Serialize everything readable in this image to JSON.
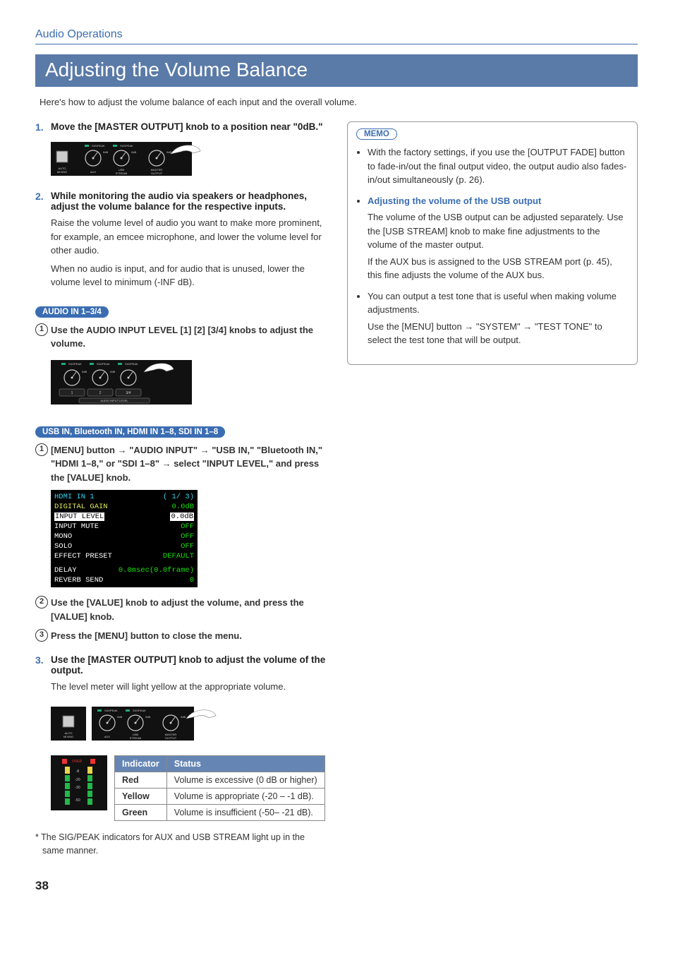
{
  "section_label": "Audio Operations",
  "title": "Adjusting the Volume Balance",
  "intro": "Here's how to adjust the volume balance of each input and the overall volume.",
  "step1": {
    "num": "1.",
    "title": "Move the [MASTER OUTPUT] knob to a position near \"0dB.\""
  },
  "step2": {
    "num": "2.",
    "title": "While monitoring the audio via speakers or headphones, adjust the volume balance for the respective inputs.",
    "p1": "Raise the volume level of audio you want to make more prominent, for example, an emcee microphone, and lower the volume level for other audio.",
    "p2": "When no audio is input, and for audio that is unused, lower the volume level to minimum (-INF dB)."
  },
  "pill_audio_in": "AUDIO IN 1–3/4",
  "sub1": {
    "text": "Use the AUDIO INPUT LEVEL [1] [2] [3/4] knobs to adjust the volume."
  },
  "pill_usb_in": "USB IN, Bluetooth IN, HDMI IN 1–8, SDI IN 1–8",
  "sub_usb1": {
    "pre": "[MENU] button ",
    "mid1": " \"AUDIO INPUT\" ",
    "mid2": " \"USB IN,\" \"Bluetooth IN,\" \"HDMI 1–8,\" or \"SDI 1–8\" ",
    "post": " select \"INPUT LEVEL,\" and press the [VALUE] knob."
  },
  "menu": {
    "r1_l": "HDMI IN 1",
    "r1_r": "( 1/ 3)",
    "r2_l": "DIGITAL GAIN",
    "r2_r": "0.0dB",
    "r3_l": "INPUT LEVEL",
    "r3_r": "0.0dB",
    "r4_l": "INPUT MUTE",
    "r4_r": "OFF",
    "r5_l": "MONO",
    "r5_r": "OFF",
    "r6_l": "SOLO",
    "r6_r": "OFF",
    "r7_l": "EFFECT PRESET",
    "r7_r": "DEFAULT",
    "r8_l": "DELAY",
    "r8_r": "0.0msec(0.0frame)",
    "r9_l": "REVERB SEND",
    "r9_r": "0"
  },
  "sub_usb2": "Use the [VALUE] knob to adjust the volume, and press the [VALUE] knob.",
  "sub_usb3": "Press the [MENU] button to close the menu.",
  "step3": {
    "num": "3.",
    "title": "Use the [MASTER OUTPUT] knob to adjust the volume of the output.",
    "p1": "The level meter will light yellow at the appropriate volume."
  },
  "table": {
    "h1": "Indicator",
    "h2": "Status",
    "rows": [
      {
        "k": "Red",
        "v": "Volume is excessive (0 dB or higher)"
      },
      {
        "k": "Yellow",
        "v": "Volume is appropriate (-20 – -1 dB)."
      },
      {
        "k": "Green",
        "v": "Volume is insufficient (-50– -21 dB)."
      }
    ]
  },
  "footnote": "* The SIG/PEAK indicators for AUX and USB STREAM light up in the same manner.",
  "memo": {
    "label": "MEMO",
    "b1": "With the factory settings, if you use the [OUTPUT FADE] button to fade-in/out the final output video, the output audio also fades-in/out simultaneously (p. 26).",
    "b2_title": "Adjusting the volume of the USB output",
    "b2_p1": "The volume of the USB output can be adjusted separately. Use the [USB STREAM] knob to make fine adjustments to the volume of the master output.",
    "b2_p2": "If the AUX bus is assigned to the USB STREAM port (p. 45), this fine adjusts the volume of the AUX bus.",
    "b3_p1": "You can output a test tone that is useful when making volume adjustments.",
    "b3_pre": "Use the [MENU] button ",
    "b3_mid1": " \"SYSTEM\" ",
    "b3_post": " \"TEST TONE\" to select the test tone that will be output."
  },
  "meter": {
    "over": "OVER",
    "m8": "-8",
    "m20": "-20",
    "m30": "-30",
    "m50": "-50"
  },
  "panel": {
    "sig_peak": "SIG/PEAK",
    "zero_db": "0dB",
    "auto_mixing1": "AUTO",
    "auto_mixing2": "MIXING",
    "aux": "AUX",
    "usb1": "USB",
    "usb2": "STREAM",
    "master1": "MASTER",
    "master2": "OUTPUT",
    "audio_input_level": "AUDIO INPUT LEVEL",
    "k1": "1",
    "k2": "2",
    "k34": "3/4"
  },
  "page_number": "38"
}
